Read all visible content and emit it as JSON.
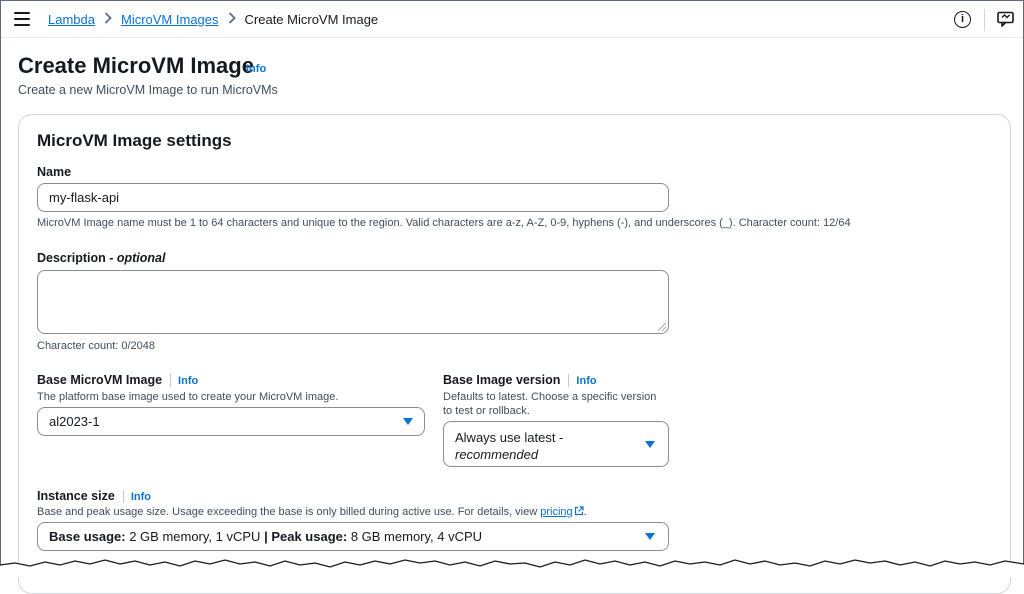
{
  "breadcrumb": {
    "items": [
      "Lambda",
      "MicroVM Images"
    ],
    "current": "Create MicroVM Image"
  },
  "header": {
    "title": "Create MicroVM Image",
    "info": "Info",
    "subtitle": "Create a new MicroVM Image to run MicroVMs"
  },
  "settings": {
    "title": "MicroVM Image settings",
    "name": {
      "label": "Name",
      "value": "my-flask-api",
      "hint": "MicroVM Image name must be 1 to 64 characters and unique to the region. Valid characters are a-z, A-Z, 0-9, hyphens (-), and underscores (_). Character count: 12/64"
    },
    "description": {
      "label": "Description - ",
      "optional": "optional",
      "value": "",
      "hint": "Character count: 0/2048"
    },
    "base_image": {
      "label": "Base MicroVM Image",
      "info": "Info",
      "hint": "The platform base image used to create your MicroVM image.",
      "value": "al2023-1"
    },
    "base_version": {
      "label": "Base Image version",
      "info": "Info",
      "hint_line1": "Defaults to latest. Choose a specific version",
      "hint_line2": "to test or rollback.",
      "value_line1": "Always use latest -",
      "value_line2": "recommended"
    },
    "instance_size": {
      "label": "Instance size",
      "info": "Info",
      "hint": "Base and peak usage size. Usage exceeding the base is only billed during active use. For details, view ",
      "hint_link": "pricing",
      "hint_end": ".",
      "base_label": "Base usage:",
      "base_value": " 2 GB memory, 1 vCPU ",
      "sep": "|",
      "peak_label": " Peak usage:",
      "peak_value": " 8 GB memory, 4 vCPU"
    }
  },
  "colors": {
    "link": "#0972d3",
    "text": "#16191f",
    "muted": "#414d5c",
    "border": "#8c8c94"
  }
}
